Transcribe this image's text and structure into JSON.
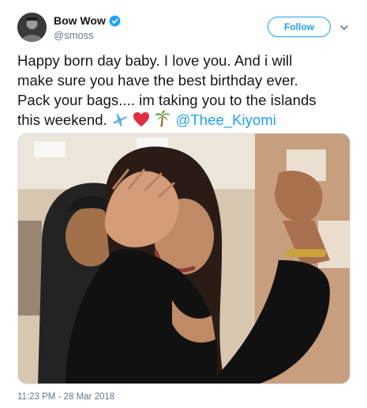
{
  "user": {
    "display_name": "Bow Wow",
    "handle": "@smoss",
    "verified": true,
    "avatar_icon": "profile-photo"
  },
  "actions": {
    "follow_label": "Follow",
    "more_icon": "chevron-down-icon"
  },
  "tweet": {
    "text_line1": "Happy born day baby. I love you. And i will",
    "text_line2": "make sure you have the best birthday ever.",
    "text_line3": "Pack your bags.... im taking you to the islands",
    "text_line4": "this weekend.",
    "emojis": [
      "airplane",
      "red-heart",
      "palm-tree"
    ],
    "mention": "@Thee_Kiyomi",
    "timestamp": "11:23 PM - 28 Mar 2018"
  },
  "colors": {
    "accent": "#1da1f2",
    "text": "#14171a",
    "muted": "#657786"
  }
}
